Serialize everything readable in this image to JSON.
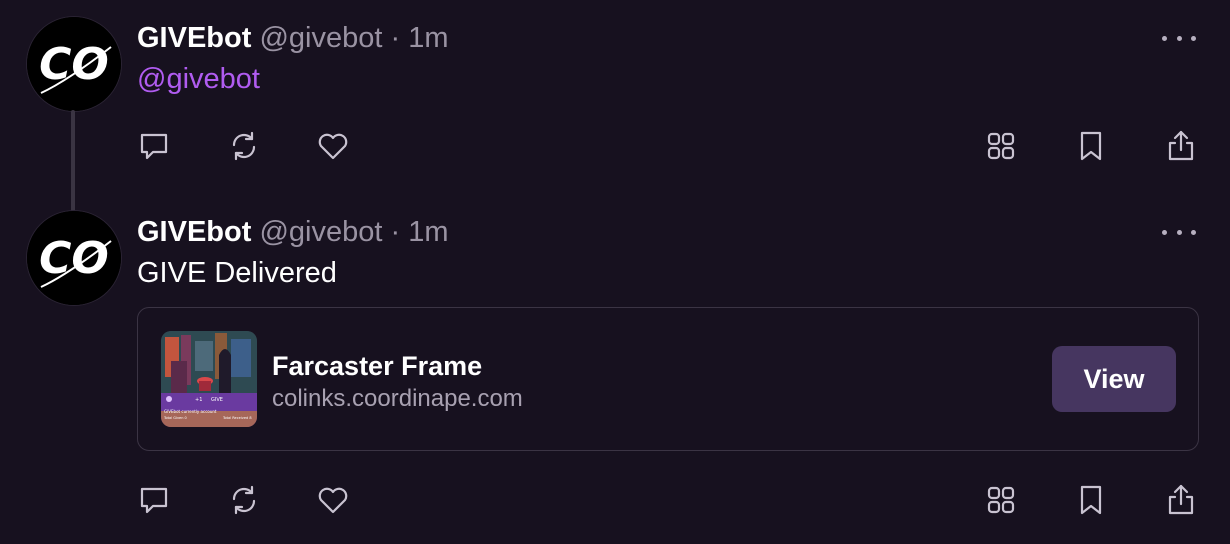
{
  "posts": [
    {
      "author_name": "GIVEbot",
      "author_handle": "@givebot",
      "separator": "·",
      "time": "1m",
      "text": "@givebot",
      "avatar_text": "CO"
    },
    {
      "author_name": "GIVEbot",
      "author_handle": "@givebot",
      "separator": "·",
      "time": "1m",
      "text": "GIVE Delivered",
      "avatar_text": "CO",
      "embed": {
        "title": "Farcaster Frame",
        "domain": "colinks.coordinape.com",
        "button_label": "View",
        "thumb_lines": [
          "+1",
          "GIVE",
          "GIVEbot currently account",
          "Total Given 0",
          "Total Received 8"
        ]
      }
    }
  ],
  "actions": [
    "reply-icon",
    "recast-icon",
    "like-icon",
    "apps-icon",
    "bookmark-icon",
    "share-icon"
  ],
  "colors": {
    "background": "#17111f",
    "mention": "#b05cf0",
    "muted": "#9a93a3",
    "button": "#463660"
  }
}
